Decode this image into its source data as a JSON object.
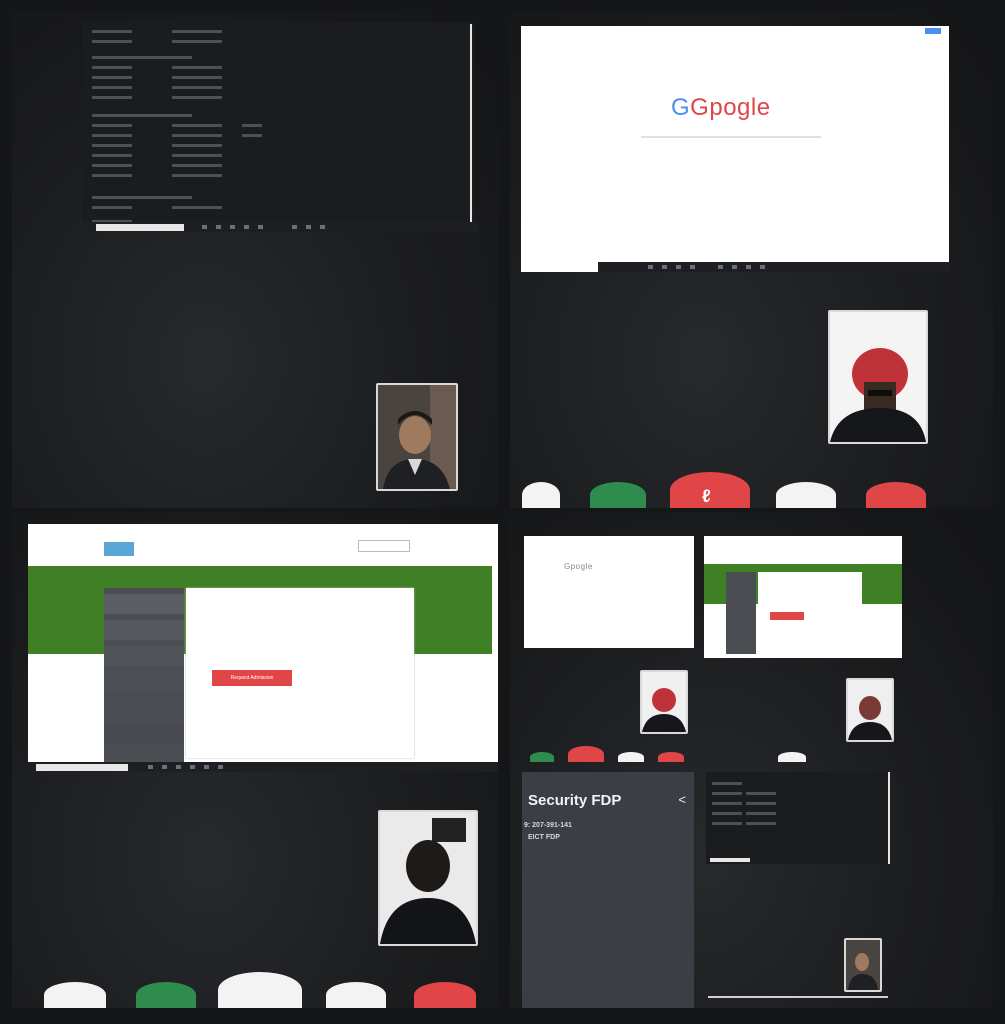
{
  "caption": "",
  "colors": {
    "background": "#151618",
    "green_banner": "#3f7f25",
    "red_button": "#e04548",
    "green_button": "#2e8c4f",
    "white_button": "#f3f3f3"
  },
  "top_right": {
    "browser_logo": "Gpogle",
    "call_hangup_glyph": "ℓ"
  },
  "bottom_right": {
    "mobile_title": "Security FDP",
    "mobile_meeting_id": "9: 207-391-141",
    "mobile_org": "EICT FDP",
    "mini_logo": "Gpogle"
  },
  "bottom_left": {
    "portal_button_label": "Request Admission"
  },
  "icons": {
    "share": "share-icon",
    "camera": "camera-icon",
    "mute": "mute-icon",
    "hangup": "hangup-icon"
  }
}
